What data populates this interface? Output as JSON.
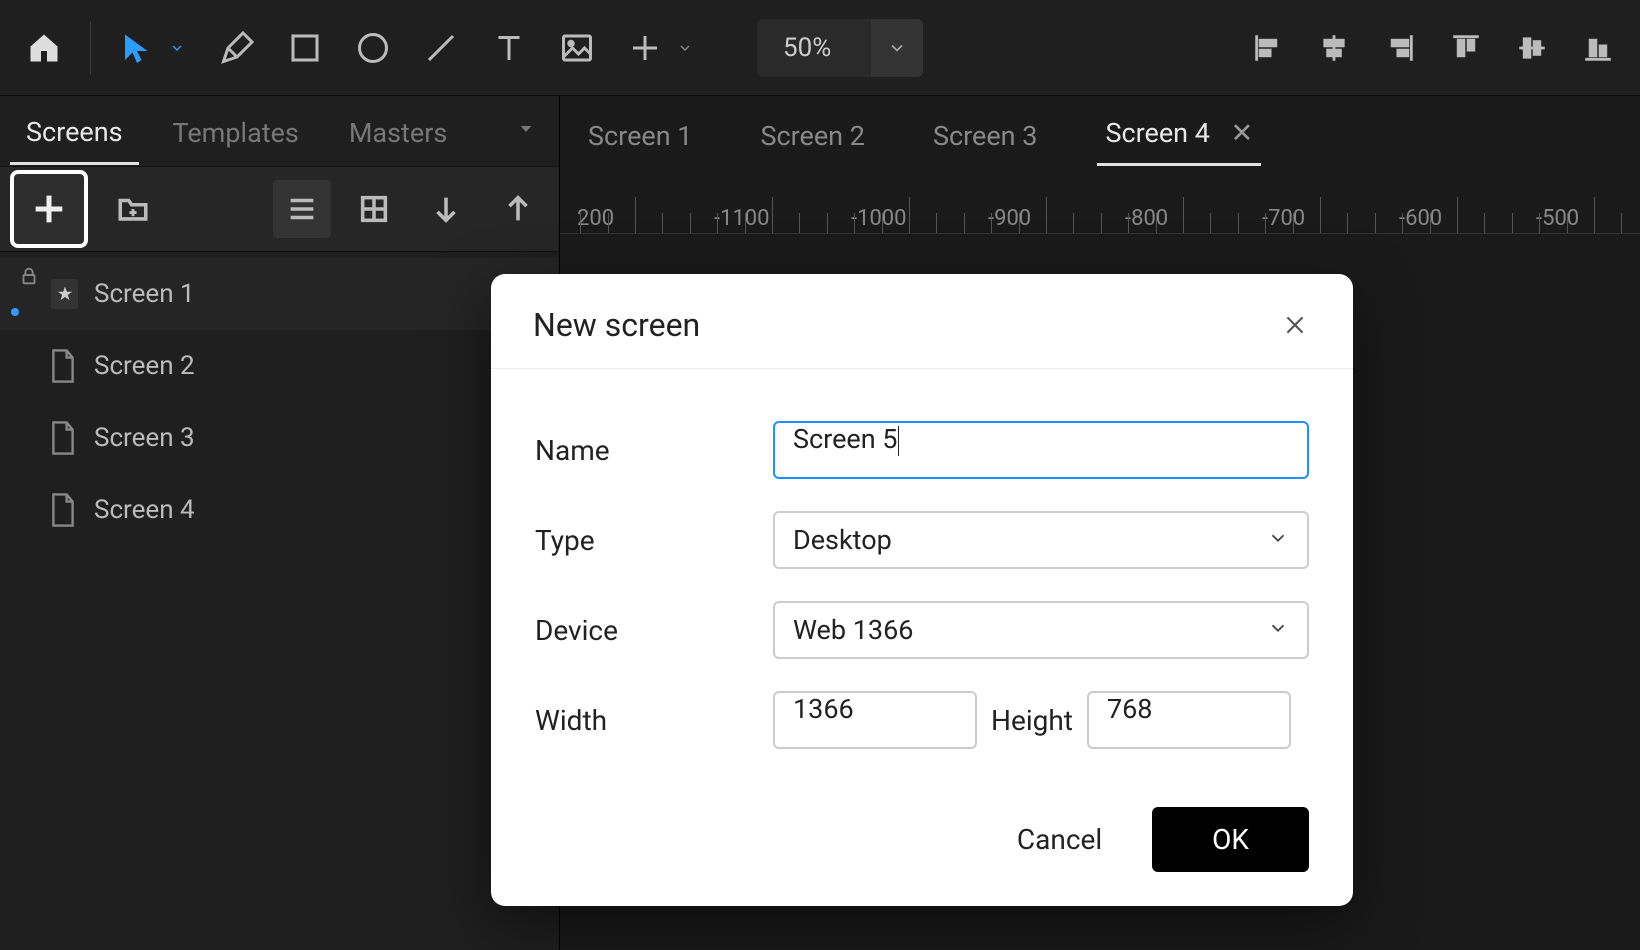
{
  "toolbar": {
    "zoom": "50%"
  },
  "sidebar": {
    "tabs": [
      "Screens",
      "Templates",
      "Masters"
    ],
    "active_tab": 0,
    "screens": [
      {
        "name": "Screen 1",
        "starred": true,
        "locked": true
      },
      {
        "name": "Screen 2",
        "starred": false,
        "locked": false
      },
      {
        "name": "Screen 3",
        "starred": false,
        "locked": false
      },
      {
        "name": "Screen 4",
        "starred": false,
        "locked": false
      }
    ]
  },
  "canvas": {
    "tabs": [
      "Screen 1",
      "Screen 2",
      "Screen 3",
      "Screen 4"
    ],
    "active_tab": 3,
    "ruler_marks": [
      "200",
      "-1100",
      "-1000",
      "-900",
      "-800",
      "-700",
      "-600",
      "-500"
    ]
  },
  "dialog": {
    "title": "New screen",
    "fields": {
      "name_label": "Name",
      "name_value": "Screen 5",
      "type_label": "Type",
      "type_value": "Desktop",
      "device_label": "Device",
      "device_value": "Web 1366",
      "width_label": "Width",
      "width_value": "1366",
      "height_label": "Height",
      "height_value": "768"
    },
    "buttons": {
      "cancel": "Cancel",
      "ok": "OK"
    }
  }
}
